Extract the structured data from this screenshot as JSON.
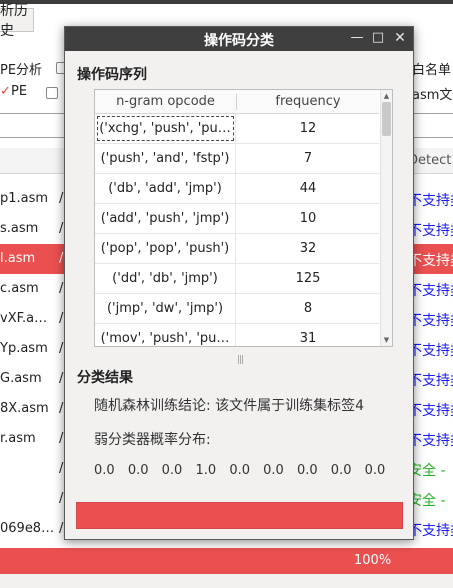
{
  "background": {
    "tab_label": "析历史",
    "options": {
      "pe_analysis": "PE分析",
      "pe": "PE",
      "whitelist": "白名单",
      "asm_file": "asm文件"
    },
    "table_header_detect": "Detect",
    "rows": [
      {
        "file": "p1.asm",
        "path": "/",
        "status": "不支持类",
        "status_color": "#1a1aff",
        "selected": false
      },
      {
        "file": "s.asm",
        "path": "/",
        "status": "不支持类",
        "status_color": "#1a1aff",
        "selected": false
      },
      {
        "file": "l.asm",
        "path": "/",
        "status": "不支持类",
        "status_color": "#ffffff",
        "selected": true
      },
      {
        "file": "c.asm",
        "path": "/",
        "status": "不支持类",
        "status_color": "#1a1aff",
        "selected": false
      },
      {
        "file": "vXF.a…",
        "path": "/",
        "status": "不支持类",
        "status_color": "#1a1aff",
        "selected": false
      },
      {
        "file": "Yp.asm",
        "path": "/",
        "status": "不支持类",
        "status_color": "#1a1aff",
        "selected": false
      },
      {
        "file": "G.asm",
        "path": "/",
        "status": "不支持类",
        "status_color": "#1a1aff",
        "selected": false
      },
      {
        "file": "8X.asm",
        "path": "/",
        "status": "不支持类",
        "status_color": "#1a1aff",
        "selected": false
      },
      {
        "file": "r.asm",
        "path": "/",
        "status": "不支持类",
        "status_color": "#1a1aff",
        "selected": false
      },
      {
        "file": "",
        "path": "/",
        "status": "安全 -",
        "status_color": "#22b322",
        "selected": false
      },
      {
        "file": "",
        "path": "/",
        "status": "安全 -",
        "status_color": "#22b322",
        "selected": false
      },
      {
        "file": "069e8…",
        "path": "/",
        "status": "不支持类",
        "status_color": "#1a1aff",
        "selected": false
      }
    ],
    "progress_text": "100%",
    "progress_color": "#ea5050"
  },
  "dialog": {
    "title": "操作码分类",
    "buttons": {
      "minimize": "—",
      "maximize": "□",
      "close": "✕"
    },
    "sequence_label": "操作码序列",
    "table": {
      "headers": [
        "n-gram opcode",
        "frequency"
      ],
      "rows": [
        {
          "opcode": "('xchg', 'push', 'pu…",
          "frequency": "12"
        },
        {
          "opcode": "('push', 'and', 'fstp')",
          "frequency": "7"
        },
        {
          "opcode": "('db', 'add', 'jmp')",
          "frequency": "44"
        },
        {
          "opcode": "('add', 'push', 'jmp')",
          "frequency": "10"
        },
        {
          "opcode": "('pop', 'pop', 'push')",
          "frequency": "32"
        },
        {
          "opcode": "('dd', 'db', 'jmp')",
          "frequency": "125"
        },
        {
          "opcode": "('jmp', 'dw', 'jmp')",
          "frequency": "8"
        },
        {
          "opcode": "('mov', 'push', 'pu…",
          "frequency": "31"
        }
      ]
    },
    "result_label": "分类结果",
    "rf_conclusion": "随机森林训练结论: 该文件属于训练集标签4",
    "weak_label": "弱分类器概率分布:",
    "probabilities": [
      "0.0",
      "0.0",
      "0.0",
      "1.0",
      "0.0",
      "0.0",
      "0.0",
      "0.0",
      "0.0"
    ],
    "accent_color": "#ea5050"
  }
}
